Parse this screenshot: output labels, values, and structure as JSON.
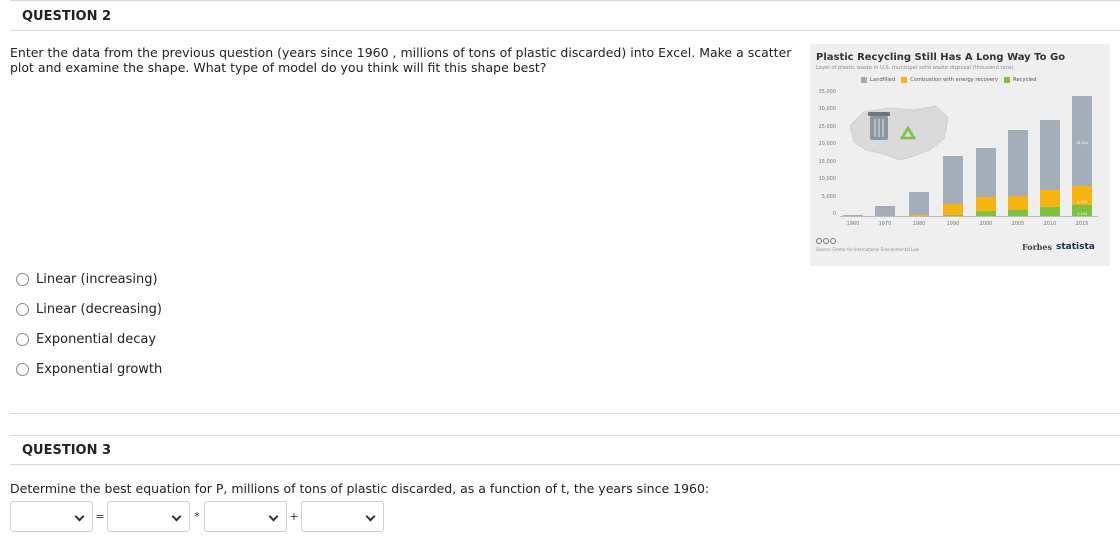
{
  "question2": {
    "header": "QUESTION 2",
    "text": "Enter the data from the previous question (years since 1960 , millions of tons of plastic discarded) into Excel.  Make a scatter plot and examine the shape. What type of model do you think will fit this shape best?",
    "options": [
      "Linear (increasing)",
      "Linear (decreasing)",
      "Exponential decay",
      "Exponential growth"
    ]
  },
  "question3": {
    "header": "QUESTION 3",
    "text": "Determine the best equation for P, millions of tons of plastic discarded, as a function of t, the years since 1960:",
    "operators": [
      "=",
      "*",
      "+"
    ]
  },
  "infographic": {
    "title": "Plastic Recycling Still Has A Long Way To Go",
    "subtitle": "Level of plastic waste in U.S. municipal solid waste disposal (thousand tons)",
    "legend": [
      "Landfilled",
      "Combustion with energy recovery",
      "Recycled"
    ],
    "colors": {
      "landfilled": "#a3aeb8",
      "combustion": "#f6b312",
      "recycled": "#7cc142"
    },
    "source": "Source: Center for International Environmental Law",
    "brand_forbes": "Forbes",
    "brand_statista": "statista",
    "label_2015_landfilled": "26,010",
    "label_2015_combustion": "5,350",
    "label_2015_recycled": "3,140"
  },
  "chart_data": {
    "type": "bar",
    "title": "Plastic Recycling Still Has A Long Way To Go",
    "subtitle": "Level of plastic waste in U.S. municipal solid waste disposal (thousand tons)",
    "categories": [
      "1960",
      "1970",
      "1980",
      "1990",
      "2000",
      "2005",
      "2010",
      "2015"
    ],
    "series": [
      {
        "name": "Landfilled",
        "values": [
          390,
          2900,
          6700,
          13780,
          14000,
          19000,
          20000,
          26010
        ]
      },
      {
        "name": "Combustion with energy recovery",
        "values": [
          0,
          0,
          140,
          2980,
          4100,
          4000,
          4900,
          5350
        ]
      },
      {
        "name": "Recycled",
        "values": [
          0,
          0,
          20,
          370,
          1480,
          1780,
          2500,
          3140
        ]
      }
    ],
    "yticks": [
      "35,000",
      "30,000",
      "25,000",
      "20,000",
      "15,000",
      "10,000",
      "5,000",
      "0"
    ],
    "ylim": [
      0,
      35000
    ],
    "legend_position": "top"
  }
}
